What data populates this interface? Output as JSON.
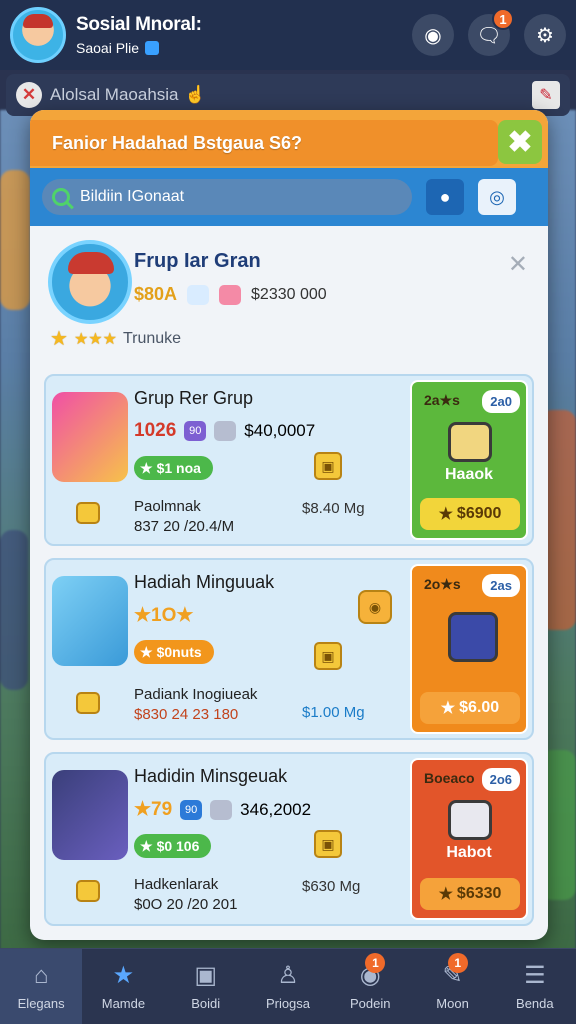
{
  "header": {
    "title": "Sosial Mnoral:",
    "subtitle": "Saoai Plie",
    "chat_badge": "1"
  },
  "secondary_bar": {
    "text": "Alolsal Maoahsia"
  },
  "modal": {
    "title": "Fanior Hadahad Bstgaua S6?",
    "search_placeholder": "Bildiin IGonaat"
  },
  "profile": {
    "name": "Frup Iar Gran",
    "gold": "$80A",
    "value": "$2330 000",
    "rank_label": "Trunuke"
  },
  "cards": [
    {
      "title": "Grup Rer Grup",
      "main_num": "1026",
      "badge": "90",
      "amount": "$40,0007",
      "pill": "$1 noa",
      "sub1": "Paolmnak",
      "sub2": "837 20 /20.4/M",
      "price": "$8.40 Mg",
      "side_tag": "2a★s",
      "side_bubble": "2a0",
      "side_label": "Haaok",
      "side_btn": "$6900"
    },
    {
      "title": "Hadiah Minguuak",
      "main_num": "★1O★",
      "pill": "$0nuts",
      "sub1": "Padiank Inogiueak",
      "sub2": "$830 24   23 180",
      "price": "$1.00 Mg",
      "side_tag": "2o★s",
      "side_bubble": "2as",
      "side_btn": "$6.00"
    },
    {
      "title": "Hadidin Minsgeuak",
      "main_num": "★79",
      "badge": "90",
      "amount": "346,2002",
      "pill": "$0 106",
      "sub1": "Hadkenlarak",
      "sub2": "$0O 20 /20 201",
      "price": "$630 Mg",
      "side_tag": "Boeaco",
      "side_bubble": "2o6",
      "side_label": "Habot",
      "side_btn": "$6330"
    }
  ],
  "nav": [
    {
      "label": "Elegans",
      "icon": "home-icon"
    },
    {
      "label": "Mamde",
      "icon": "star-icon"
    },
    {
      "label": "Boidi",
      "icon": "camera-icon"
    },
    {
      "label": "Priogsa",
      "icon": "person-icon"
    },
    {
      "label": "Podein",
      "icon": "chat-icon",
      "badge": "1"
    },
    {
      "label": "Moon",
      "icon": "edit-icon",
      "badge": "1"
    },
    {
      "label": "Benda",
      "icon": "menu-icon"
    }
  ],
  "colors": {
    "modal_header": "#f0902a",
    "close_green": "#8cc640",
    "search_blue": "#2c86d2",
    "card_bg": "#d9ecf9",
    "panel_green": "#5cb83c",
    "panel_orange": "#f08a1c",
    "panel_red": "#e2552a"
  }
}
